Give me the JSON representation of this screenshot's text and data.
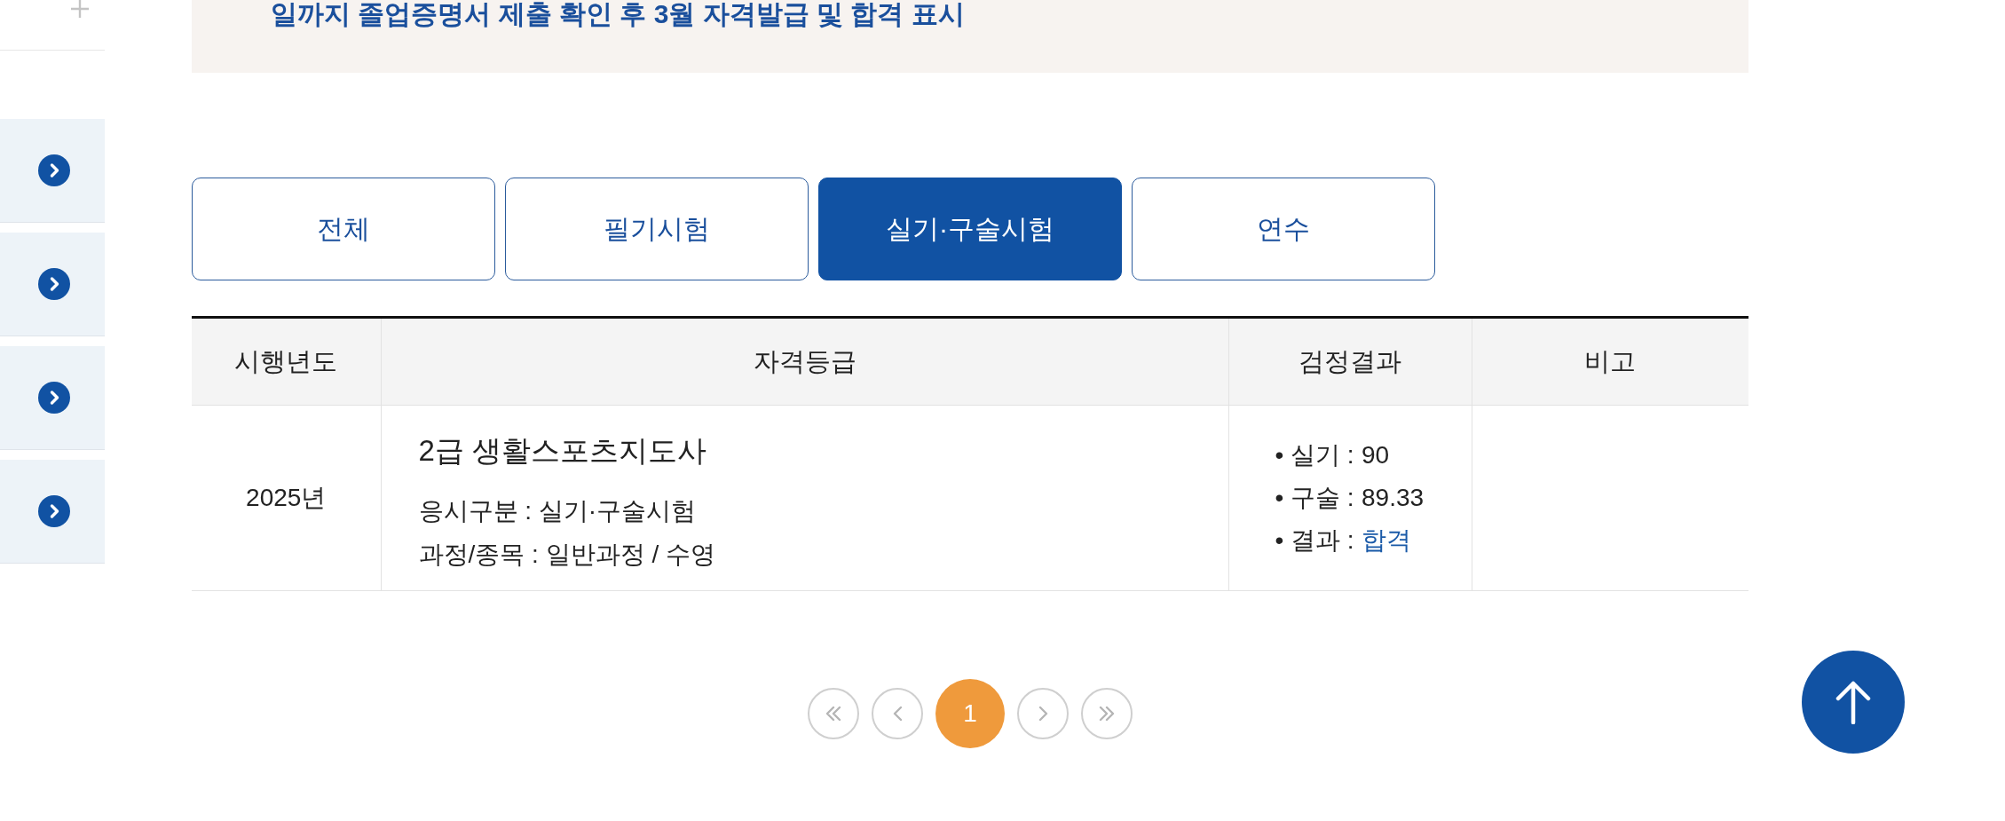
{
  "sidebar": {
    "toggle": {
      "expanded": false
    },
    "items": [
      {
        "kind": "link"
      },
      {
        "kind": "link"
      },
      {
        "kind": "link"
      },
      {
        "kind": "link"
      }
    ]
  },
  "notice": {
    "text": "일까지 졸업증명서 제출 확인 후 3월 자격발급 및 합격 표시"
  },
  "tabs": [
    {
      "label": "전체",
      "selected": false
    },
    {
      "label": "필기시험",
      "selected": false
    },
    {
      "label": "실기·구술시험",
      "selected": true
    },
    {
      "label": "연수",
      "selected": false
    }
  ],
  "table": {
    "columns": [
      "시행년도",
      "자격등급",
      "검정결과",
      "비고"
    ],
    "rows": [
      {
        "year": "2025년",
        "grade": {
          "title": "2급 생활스포츠지도사",
          "details": [
            "응시구분 : 실기·구술시험",
            "과정/종목 : 일반과정 / 수영"
          ]
        },
        "results": [
          {
            "label": "• 실기 :",
            "value": "90",
            "highlight": false
          },
          {
            "label": "• 구술 :",
            "value": "89.33",
            "highlight": false
          },
          {
            "label": "• 결과 :",
            "value": "합격",
            "highlight": true
          }
        ]
      }
    ]
  },
  "pager": {
    "buttons": [
      {
        "kind": "first"
      },
      {
        "kind": "prev"
      },
      {
        "kind": "page",
        "label": "1",
        "selected": true
      },
      {
        "kind": "next"
      },
      {
        "kind": "last"
      }
    ]
  },
  "scroll_top_button": true
}
